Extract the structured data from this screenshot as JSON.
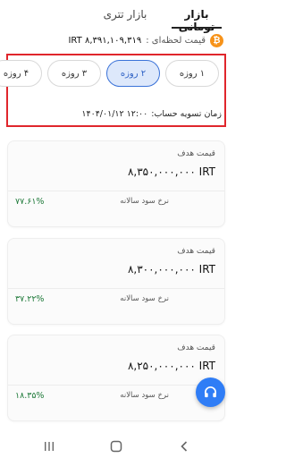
{
  "tabs": {
    "toman": "بازار تومانی",
    "tether": "بازار تتری"
  },
  "live_price": {
    "icon": "bitcoin-icon",
    "label": "قیمت لحظه‌ای :",
    "value": "IRT ۸,۳۹۱,۱۰۹,۳۱۹"
  },
  "durations": {
    "options": [
      "۱ روزه",
      "۲ روزه",
      "۳ روزه",
      "۴ روزه"
    ],
    "selected": "۲ روزه"
  },
  "settlement": {
    "label": "زمان تسویه حساب:",
    "value": "۱۴۰۴/۰۱/۱۲ ۱۲:۰۰"
  },
  "cards": [
    {
      "target_label": "قیمت هدف",
      "target_price": "۸,۳۵۰,۰۰۰,۰۰۰ IRT",
      "apr_label": "نرخ سود سالانه",
      "apr_value": "۷۷.۶۱%"
    },
    {
      "target_label": "قیمت هدف",
      "target_price": "۸,۳۰۰,۰۰۰,۰۰۰ IRT",
      "apr_label": "نرخ سود سالانه",
      "apr_value": "۳۷.۲۲%"
    },
    {
      "target_label": "قیمت هدف",
      "target_price": "۸,۲۵۰,۰۰۰,۰۰۰ IRT",
      "apr_label": "نرخ سود سالانه",
      "apr_value": "۱۸.۳۵%"
    }
  ],
  "fab": {
    "icon": "headset-icon"
  },
  "navbar": {
    "icons": [
      "recents-icon",
      "home-icon",
      "back-icon"
    ]
  },
  "colors": {
    "accent": "#2f7df6",
    "highlight_border": "#e0262c",
    "positive": "#1f7a3a",
    "bitcoin": "#f7931a"
  }
}
